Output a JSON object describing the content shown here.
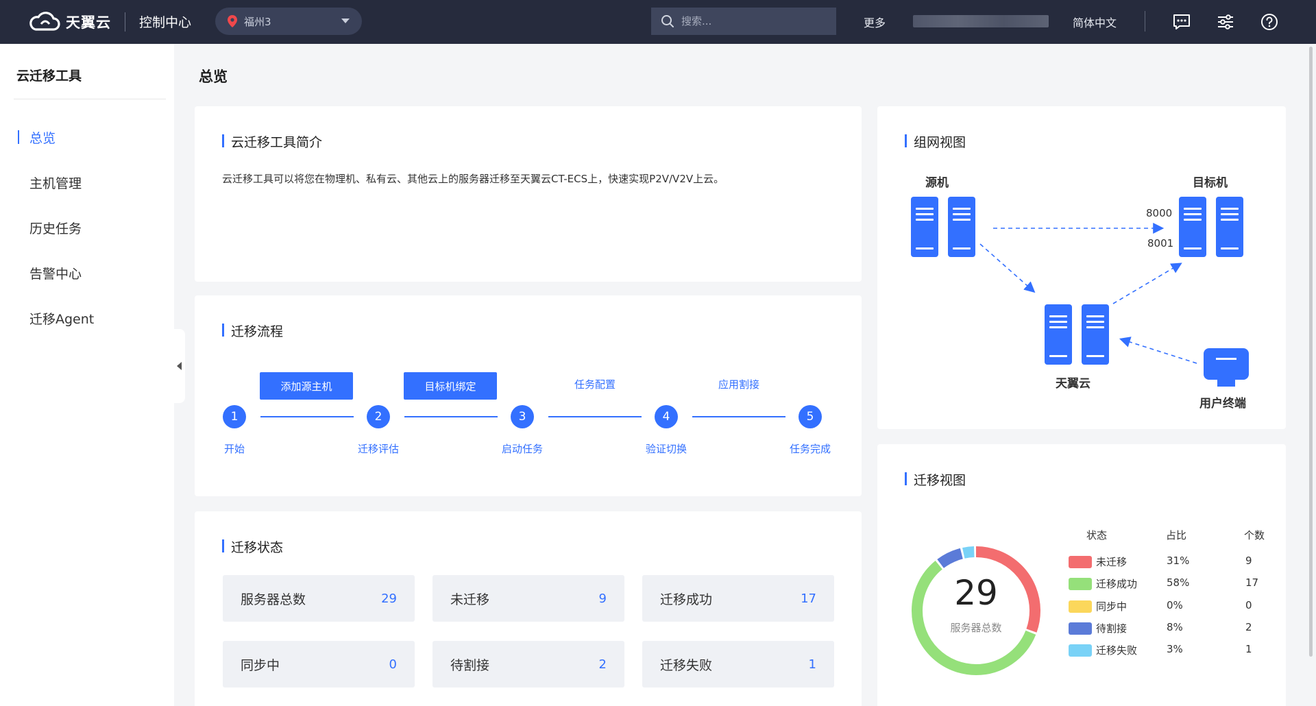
{
  "brand": {
    "logo_text": "天翼云",
    "console": "控制中心"
  },
  "region": {
    "label": "福州3"
  },
  "search": {
    "placeholder": "搜索..."
  },
  "topbar": {
    "more": "更多",
    "language": "简体中文"
  },
  "sidebar": {
    "title": "云迁移工具",
    "items": [
      {
        "label": "总览",
        "active": true
      },
      {
        "label": "主机管理"
      },
      {
        "label": "历史任务"
      },
      {
        "label": "告警中心"
      },
      {
        "label": "迁移Agent"
      }
    ]
  },
  "page": {
    "title": "总览"
  },
  "intro": {
    "title": "云迁移工具简介",
    "text": "云迁移工具可以将您在物理机、私有云、其他云上的服务器迁移至天翼云CT-ECS上，快速实现P2V/V2V上云。"
  },
  "flow": {
    "title": "迁移流程",
    "steps": [
      {
        "num": "1",
        "label": "开始"
      },
      {
        "num": "2",
        "label": "迁移评估"
      },
      {
        "num": "3",
        "label": "启动任务"
      },
      {
        "num": "4",
        "label": "验证切换"
      },
      {
        "num": "5",
        "label": "任务完成"
      }
    ],
    "actions": [
      {
        "label": "添加源主机",
        "type": "button"
      },
      {
        "label": "目标机绑定",
        "type": "button"
      },
      {
        "label": "任务配置",
        "type": "link"
      },
      {
        "label": "应用割接",
        "type": "link"
      }
    ]
  },
  "status": {
    "title": "迁移状态",
    "tiles": [
      {
        "label": "服务器总数",
        "value": "29"
      },
      {
        "label": "未迁移",
        "value": "9"
      },
      {
        "label": "迁移成功",
        "value": "17"
      },
      {
        "label": "同步中",
        "value": "0"
      },
      {
        "label": "待割接",
        "value": "2"
      },
      {
        "label": "迁移失败",
        "value": "1"
      }
    ]
  },
  "network": {
    "title": "组网视图",
    "source": "源机",
    "target": "目标机",
    "cloud": "天翼云",
    "terminal": "用户终端",
    "ports": [
      "8000",
      "8001"
    ]
  },
  "migration": {
    "title": "迁移视图",
    "total": "29",
    "total_label": "服务器总数",
    "headers": {
      "status": "状态",
      "ratio": "占比",
      "count": "个数"
    },
    "rows": [
      {
        "name": "未迁移",
        "pct": "31%",
        "count": "9",
        "color": "#f36d6f"
      },
      {
        "name": "迁移成功",
        "pct": "58%",
        "count": "17",
        "color": "#95e07a"
      },
      {
        "name": "同步中",
        "pct": "0%",
        "count": "0",
        "color": "#fbd75b"
      },
      {
        "name": "待割接",
        "pct": "8%",
        "count": "2",
        "color": "#5b7bd8"
      },
      {
        "name": "迁移失败",
        "pct": "3%",
        "count": "1",
        "color": "#79d2f7"
      }
    ]
  },
  "colors": {
    "accent": "#3370ff",
    "topbar": "#262b3d"
  }
}
